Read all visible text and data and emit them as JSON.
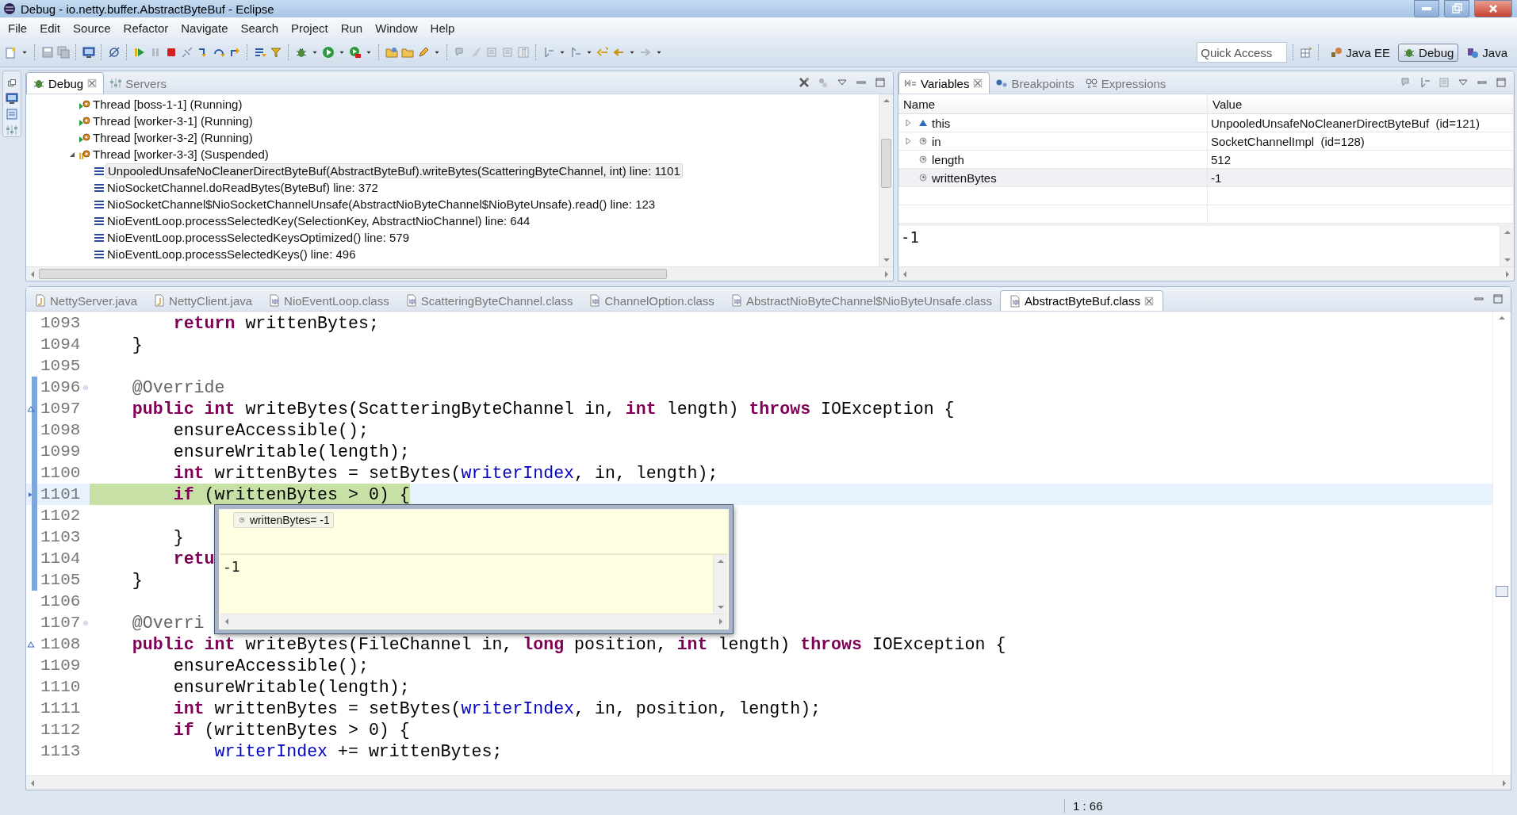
{
  "window": {
    "title": "Debug - io.netty.buffer.AbstractByteBuf - Eclipse"
  },
  "menu": [
    "File",
    "Edit",
    "Source",
    "Refactor",
    "Navigate",
    "Search",
    "Project",
    "Run",
    "Window",
    "Help"
  ],
  "quick_access": {
    "placeholder": "Quick Access"
  },
  "perspectives": [
    {
      "label": "Java EE",
      "kind": "javaee",
      "selected": false
    },
    {
      "label": "Debug",
      "kind": "debug",
      "selected": true
    },
    {
      "label": "Java",
      "kind": "java",
      "selected": false
    }
  ],
  "debug_view": {
    "tabs": [
      {
        "label": "Debug",
        "kind": "debug",
        "selected": true
      },
      {
        "label": "Servers",
        "kind": "servers",
        "selected": false
      }
    ],
    "threads": [
      {
        "label": "Thread [boss-1-1] (Running)",
        "suspended": false,
        "expanded": false
      },
      {
        "label": "Thread [worker-3-1] (Running)",
        "suspended": false,
        "expanded": false
      },
      {
        "label": "Thread [worker-3-2] (Running)",
        "suspended": false,
        "expanded": false
      },
      {
        "label": "Thread [worker-3-3] (Suspended)",
        "suspended": true,
        "expanded": true,
        "children": [
          {
            "label": "UnpooledUnsafeNoCleanerDirectByteBuf(AbstractByteBuf).writeBytes(ScatteringByteChannel, int) line: 1101",
            "selected": true
          },
          {
            "label": "NioSocketChannel.doReadBytes(ByteBuf) line: 372",
            "selected": false
          },
          {
            "label": "NioSocketChannel$NioSocketChannelUnsafe(AbstractNioByteChannel$NioByteUnsafe).read() line: 123",
            "selected": false
          },
          {
            "label": "NioEventLoop.processSelectedKey(SelectionKey, AbstractNioChannel) line: 644",
            "selected": false
          },
          {
            "label": "NioEventLoop.processSelectedKeysOptimized() line: 579",
            "selected": false
          },
          {
            "label": "NioEventLoop.processSelectedKeys() line: 496",
            "selected": false
          }
        ]
      }
    ]
  },
  "variables_view": {
    "tabs": [
      {
        "label": "Variables",
        "kind": "variables",
        "selected": true
      },
      {
        "label": "Breakpoints",
        "kind": "breakpoints",
        "selected": false
      },
      {
        "label": "Expressions",
        "kind": "expressions",
        "selected": false
      }
    ],
    "columns": [
      "Name",
      "Value"
    ],
    "rows": [
      {
        "name": "this",
        "value": "UnpooledUnsafeNoCleanerDirectByteBuf  (id=121)",
        "kind": "field",
        "expandable": true,
        "selected": false
      },
      {
        "name": "in",
        "value": "SocketChannelImpl  (id=128)",
        "kind": "local",
        "expandable": true,
        "selected": false
      },
      {
        "name": "length",
        "value": "512",
        "kind": "local",
        "expandable": false,
        "selected": false
      },
      {
        "name": "writtenBytes",
        "value": "-1",
        "kind": "local",
        "expandable": false,
        "selected": true
      }
    ],
    "detail": "-1"
  },
  "editor": {
    "tabs": [
      {
        "label": "NettyServer.java",
        "kind": "java",
        "selected": false
      },
      {
        "label": "NettyClient.java",
        "kind": "java",
        "selected": false
      },
      {
        "label": "NioEventLoop.class",
        "kind": "class",
        "selected": false
      },
      {
        "label": "ScatteringByteChannel.class",
        "kind": "class",
        "selected": false
      },
      {
        "label": "ChannelOption.class",
        "kind": "class",
        "selected": false
      },
      {
        "label": "AbstractNioByteChannel$NioByteUnsafe.class",
        "kind": "class",
        "selected": false
      },
      {
        "label": "AbstractByteBuf.class",
        "kind": "class",
        "selected": true
      }
    ],
    "lines": [
      {
        "number": "1093",
        "kind": "plain",
        "in_range": false,
        "current": false,
        "segments": [
          {
            "text": "        return",
            "kind": "keyword"
          },
          {
            "text": " writtenBytes;",
            "kind": "plain"
          }
        ]
      },
      {
        "number": "1094",
        "kind": "plain",
        "in_range": false,
        "current": false,
        "segments": [
          {
            "text": "    }",
            "kind": "plain"
          }
        ]
      },
      {
        "number": "1095",
        "kind": "plain",
        "in_range": false,
        "current": false
      },
      {
        "number": "1096",
        "kind": "fold",
        "in_range": true,
        "current": false,
        "segments": [
          {
            "text": "    @Override",
            "kind": "annotation"
          }
        ]
      },
      {
        "number": "1097",
        "kind": "override",
        "in_range": true,
        "current": false,
        "segments": [
          {
            "text": "    public int",
            "kind": "keyword"
          },
          {
            "text": " writeBytes(ScatteringByteChannel in, ",
            "kind": "plain"
          },
          {
            "text": "int",
            "kind": "keyword"
          },
          {
            "text": " length) ",
            "kind": "plain"
          },
          {
            "text": "throws",
            "kind": "keyword"
          },
          {
            "text": " IOException {",
            "kind": "plain"
          }
        ]
      },
      {
        "number": "1098",
        "kind": "plain",
        "in_range": true,
        "current": false,
        "segments": [
          {
            "text": "        ensureAccessible();",
            "kind": "plain"
          }
        ]
      },
      {
        "number": "1099",
        "kind": "plain",
        "in_range": true,
        "current": false,
        "segments": [
          {
            "text": "        ensureWritable(length);",
            "kind": "plain"
          }
        ]
      },
      {
        "number": "1100",
        "kind": "plain",
        "in_range": true,
        "current": false,
        "segments": [
          {
            "text": "        int",
            "kind": "keyword"
          },
          {
            "text": " writtenBytes = setBytes(",
            "kind": "plain"
          },
          {
            "text": "writerIndex",
            "kind": "field"
          },
          {
            "text": ", in, length);",
            "kind": "plain"
          }
        ]
      },
      {
        "number": "1101",
        "kind": "instruction",
        "in_range": true,
        "current": true,
        "segments": [
          {
            "text": "        if",
            "kind": "keyword"
          },
          {
            "text": " (writtenBytes > 0) {",
            "kind": "plain"
          }
        ]
      },
      {
        "number": "1102",
        "kind": "plain",
        "in_range": true,
        "current": false
      },
      {
        "number": "1103",
        "kind": "plain",
        "in_range": true,
        "current": false,
        "segments": [
          {
            "text": "        }",
            "kind": "plain"
          }
        ]
      },
      {
        "number": "1104",
        "kind": "plain",
        "in_range": true,
        "current": false,
        "segments": [
          {
            "text": "        retu",
            "kind": "keyword"
          }
        ]
      },
      {
        "number": "1105",
        "kind": "plain",
        "in_range": true,
        "current": false,
        "segments": [
          {
            "text": "    }",
            "kind": "plain"
          }
        ]
      },
      {
        "number": "1106",
        "kind": "plain",
        "in_range": false,
        "current": false
      },
      {
        "number": "1107",
        "kind": "fold",
        "in_range": false,
        "current": false,
        "segments": [
          {
            "text": "    @Overri",
            "kind": "annotation"
          }
        ]
      },
      {
        "number": "1108",
        "kind": "override",
        "in_range": false,
        "current": false,
        "segments": [
          {
            "text": "    public int",
            "kind": "keyword"
          },
          {
            "text": " writeBytes(FileChannel in, ",
            "kind": "plain"
          },
          {
            "text": "long",
            "kind": "keyword"
          },
          {
            "text": " position, ",
            "kind": "plain"
          },
          {
            "text": "int",
            "kind": "keyword"
          },
          {
            "text": " length) ",
            "kind": "plain"
          },
          {
            "text": "throws",
            "kind": "keyword"
          },
          {
            "text": " IOException {",
            "kind": "plain"
          }
        ]
      },
      {
        "number": "1109",
        "kind": "plain",
        "in_range": false,
        "current": false,
        "segments": [
          {
            "text": "        ensureAccessible();",
            "kind": "plain"
          }
        ]
      },
      {
        "number": "1110",
        "kind": "plain",
        "in_range": false,
        "current": false,
        "segments": [
          {
            "text": "        ensureWritable(length);",
            "kind": "plain"
          }
        ]
      },
      {
        "number": "1111",
        "kind": "plain",
        "in_range": false,
        "current": false,
        "segments": [
          {
            "text": "        int",
            "kind": "keyword"
          },
          {
            "text": " writtenBytes = setBytes(",
            "kind": "plain"
          },
          {
            "text": "writerIndex",
            "kind": "field"
          },
          {
            "text": ", in, position, length);",
            "kind": "plain"
          }
        ]
      },
      {
        "number": "1112",
        "kind": "plain",
        "in_range": false,
        "current": false,
        "segments": [
          {
            "text": "        if",
            "kind": "keyword"
          },
          {
            "text": " (writtenBytes > 0) {",
            "kind": "plain"
          }
        ]
      },
      {
        "number": "1113",
        "kind": "plain",
        "in_range": false,
        "current": false,
        "segments": [
          {
            "text": "            writerIndex",
            "kind": "field"
          },
          {
            "text": " += writtenBytes;",
            "kind": "plain"
          }
        ]
      }
    ],
    "hover": {
      "variable": "writtenBytes= -1",
      "detail": "-1"
    }
  },
  "status_bar": {
    "position": "1 : 66"
  }
}
